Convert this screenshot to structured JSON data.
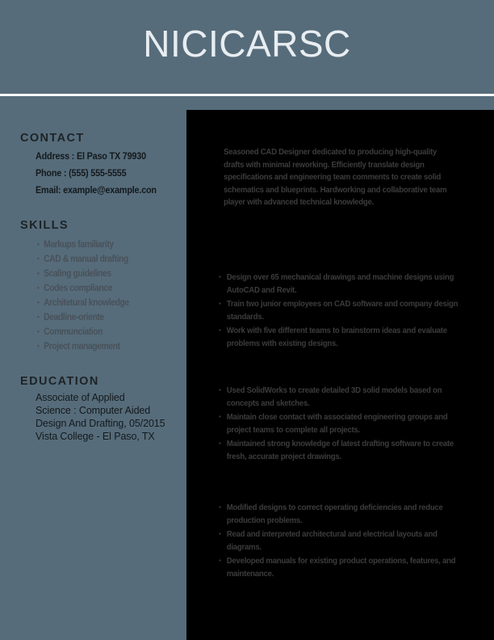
{
  "header": {
    "name": "NICICARSC"
  },
  "left_column": {
    "contact": {
      "heading": "CONTACT",
      "lines": [
        "Address : El Paso TX 79930",
        "Phone : (555) 555-5555",
        "Email: example@example.con"
      ]
    },
    "skills": {
      "heading": "SKILLS",
      "items": [
        "Markups familiarity",
        "CAD & manual drafting",
        "Scaling guidelines",
        "Codes compliance",
        "Architetural knowledge",
        "Deadline-oriente",
        "Communciation",
        "Project management"
      ]
    },
    "education": {
      "heading": "EDUCATION",
      "lines": [
        "Associate of Applied",
        "Science : Computer Aided",
        "Design And Drafting, 05/2015",
        "Vista College - El Paso, TX"
      ]
    }
  },
  "right_panel": {
    "summary": "Seasoned CAD Designer dedicated to producing high-quality drafts with minimal reworking. Efficiently translate design specifications and engineering team comments to create solid schematics and blueprints. Hardworking and collaborative team player with advanced technical knowledge.",
    "experience_blocks": [
      {
        "bullets": [
          "Design over 65 mechanical drawings and machine designs using AutoCAD and Revit.",
          "Train two junior employees on CAD software and company design standards.",
          "Work with five different teams to brainstorm ideas and evaluate problems with existing designs."
        ]
      },
      {
        "bullets": [
          "Used SolidWorks to create detailed 3D solid models based on concepts and sketches.",
          "Maintain close contact with associated engineering groups and project teams to complete all projects.",
          "Maintained strong knowledge of latest drafting software to create fresh, accurate project drawings."
        ]
      },
      {
        "bullets": [
          "Modified designs to correct operating deficiencies and reduce production problems.",
          "Read and interpreted architectural and electrical layouts and diagrams.",
          "Developed manuals for existing product operations, features, and maintenance."
        ]
      }
    ]
  },
  "colors": {
    "slate_panel": "#566c7a",
    "dark_panel": "#000000",
    "header_text": "#e8edf1",
    "heading_text": "#1d2327",
    "muted_text": "#49515a",
    "panel_text": "#3c3c3c",
    "rule": "#ffffff"
  }
}
